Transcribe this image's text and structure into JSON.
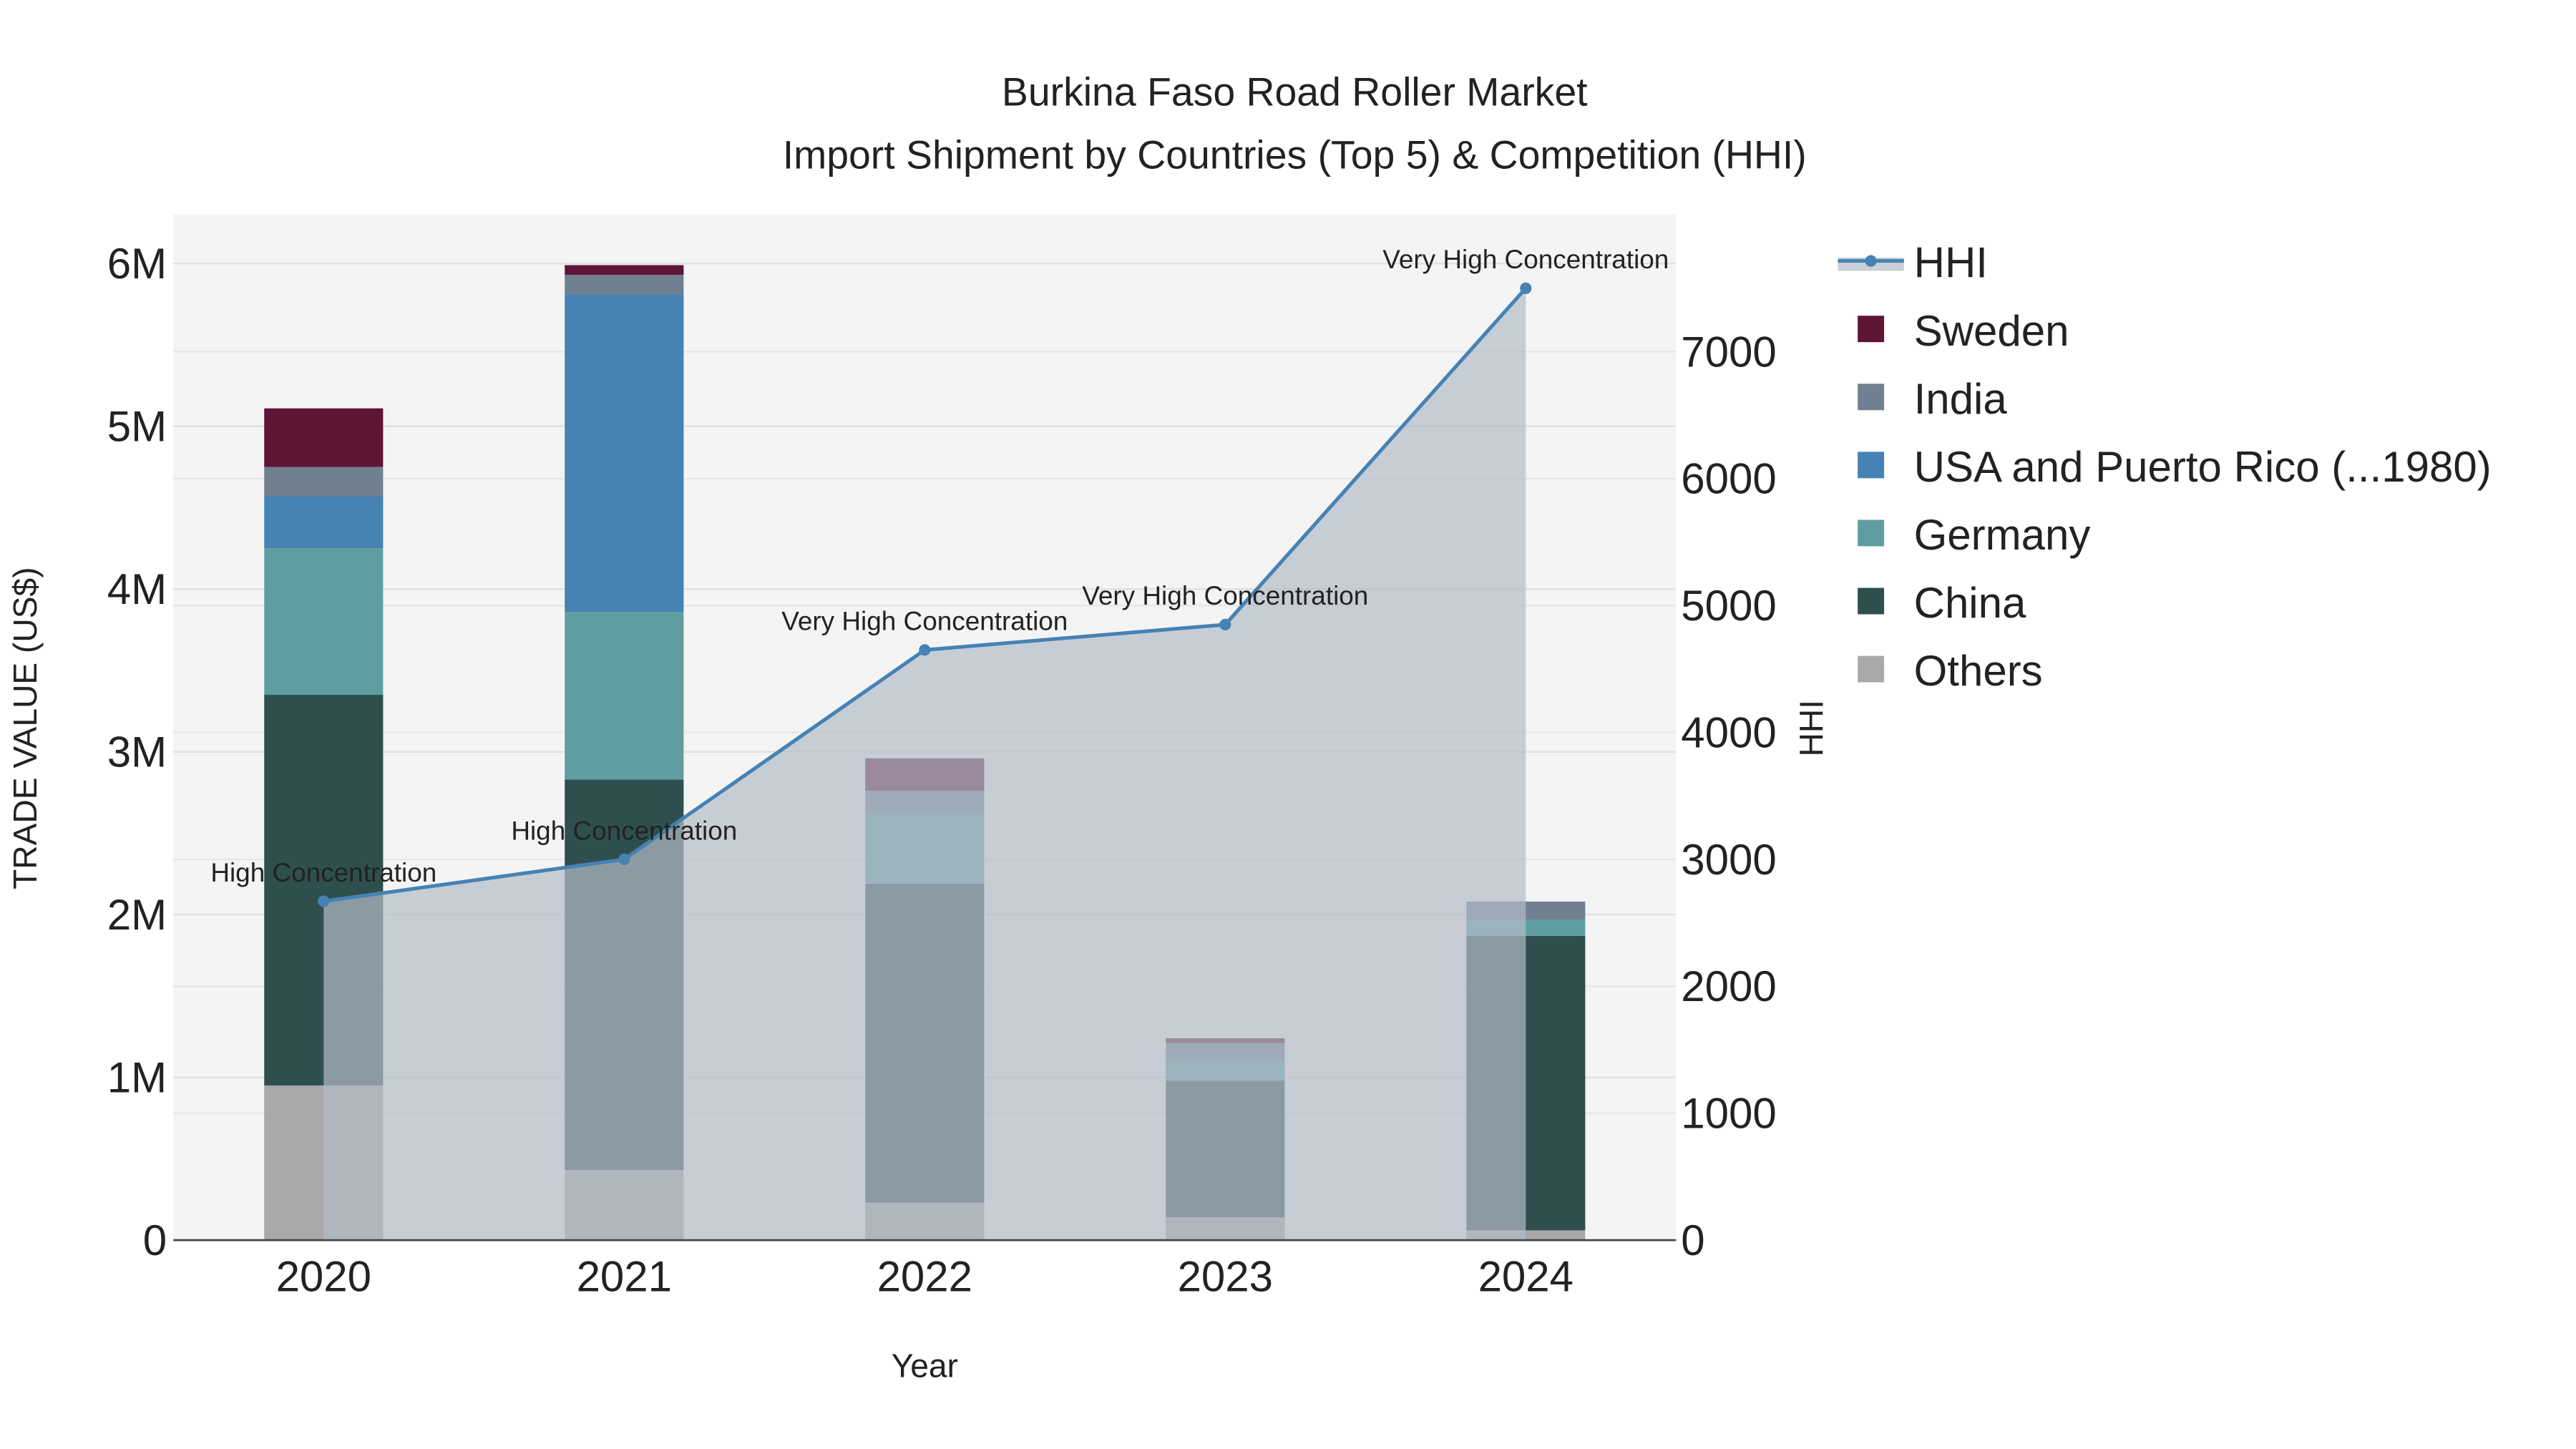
{
  "chart_data": {
    "type": "bar",
    "title": "Burkina Faso Road Roller Market",
    "subtitle": "Import Shipment by Countries (Top 5) & Competition (HHI)",
    "xlabel": "Year",
    "ylabel": "TRADE VALUE (US$)",
    "y2label": "HHI",
    "categories": [
      "2020",
      "2021",
      "2022",
      "2023",
      "2024"
    ],
    "ylim": [
      0,
      6300000
    ],
    "y2lim": [
      0,
      8080
    ],
    "yticks": [
      {
        "v": 0,
        "label": "0"
      },
      {
        "v": 1000000,
        "label": "1M"
      },
      {
        "v": 2000000,
        "label": "2M"
      },
      {
        "v": 3000000,
        "label": "3M"
      },
      {
        "v": 4000000,
        "label": "4M"
      },
      {
        "v": 5000000,
        "label": "5M"
      },
      {
        "v": 6000000,
        "label": "6M"
      }
    ],
    "y2ticks": [
      {
        "v": 0,
        "label": "0"
      },
      {
        "v": 1000,
        "label": "1000"
      },
      {
        "v": 2000,
        "label": "2000"
      },
      {
        "v": 3000,
        "label": "3000"
      },
      {
        "v": 4000,
        "label": "4000"
      },
      {
        "v": 5000,
        "label": "5000"
      },
      {
        "v": 6000,
        "label": "6000"
      },
      {
        "v": 7000,
        "label": "7000"
      }
    ],
    "series": [
      {
        "name": "Others",
        "color": "#a9a9a9",
        "values": [
          950000,
          430000,
          230000,
          140000,
          60000
        ]
      },
      {
        "name": "China",
        "color": "#2f4f4f",
        "values": [
          2400000,
          2400000,
          1960000,
          840000,
          1810000
        ]
      },
      {
        "name": "Germany",
        "color": "#5f9ea0",
        "values": [
          900000,
          1030000,
          440000,
          130000,
          100000
        ]
      },
      {
        "name": "USA and Puerto Rico (...1980)",
        "color": "#4682b4",
        "values": [
          320000,
          1950000,
          0,
          0,
          0
        ]
      },
      {
        "name": "India",
        "color": "#708090",
        "values": [
          180000,
          120000,
          130000,
          100000,
          110000
        ]
      },
      {
        "name": "Sweden",
        "color": "#5f1536",
        "values": [
          360000,
          60000,
          200000,
          30000,
          0
        ]
      }
    ],
    "hhi": {
      "name": "HHI",
      "color": "#4682b4",
      "values": [
        2670,
        3000,
        4650,
        4850,
        7500
      ],
      "labels": [
        "High Concentration",
        "High Concentration",
        "Very High Concentration",
        "Very High Concentration",
        "Very High Concentration"
      ]
    },
    "legend_order": [
      "HHI",
      "Sweden",
      "India",
      "USA and Puerto Rico (...1980)",
      "Germany",
      "China",
      "Others"
    ],
    "legend_position": "right",
    "grid": true
  }
}
